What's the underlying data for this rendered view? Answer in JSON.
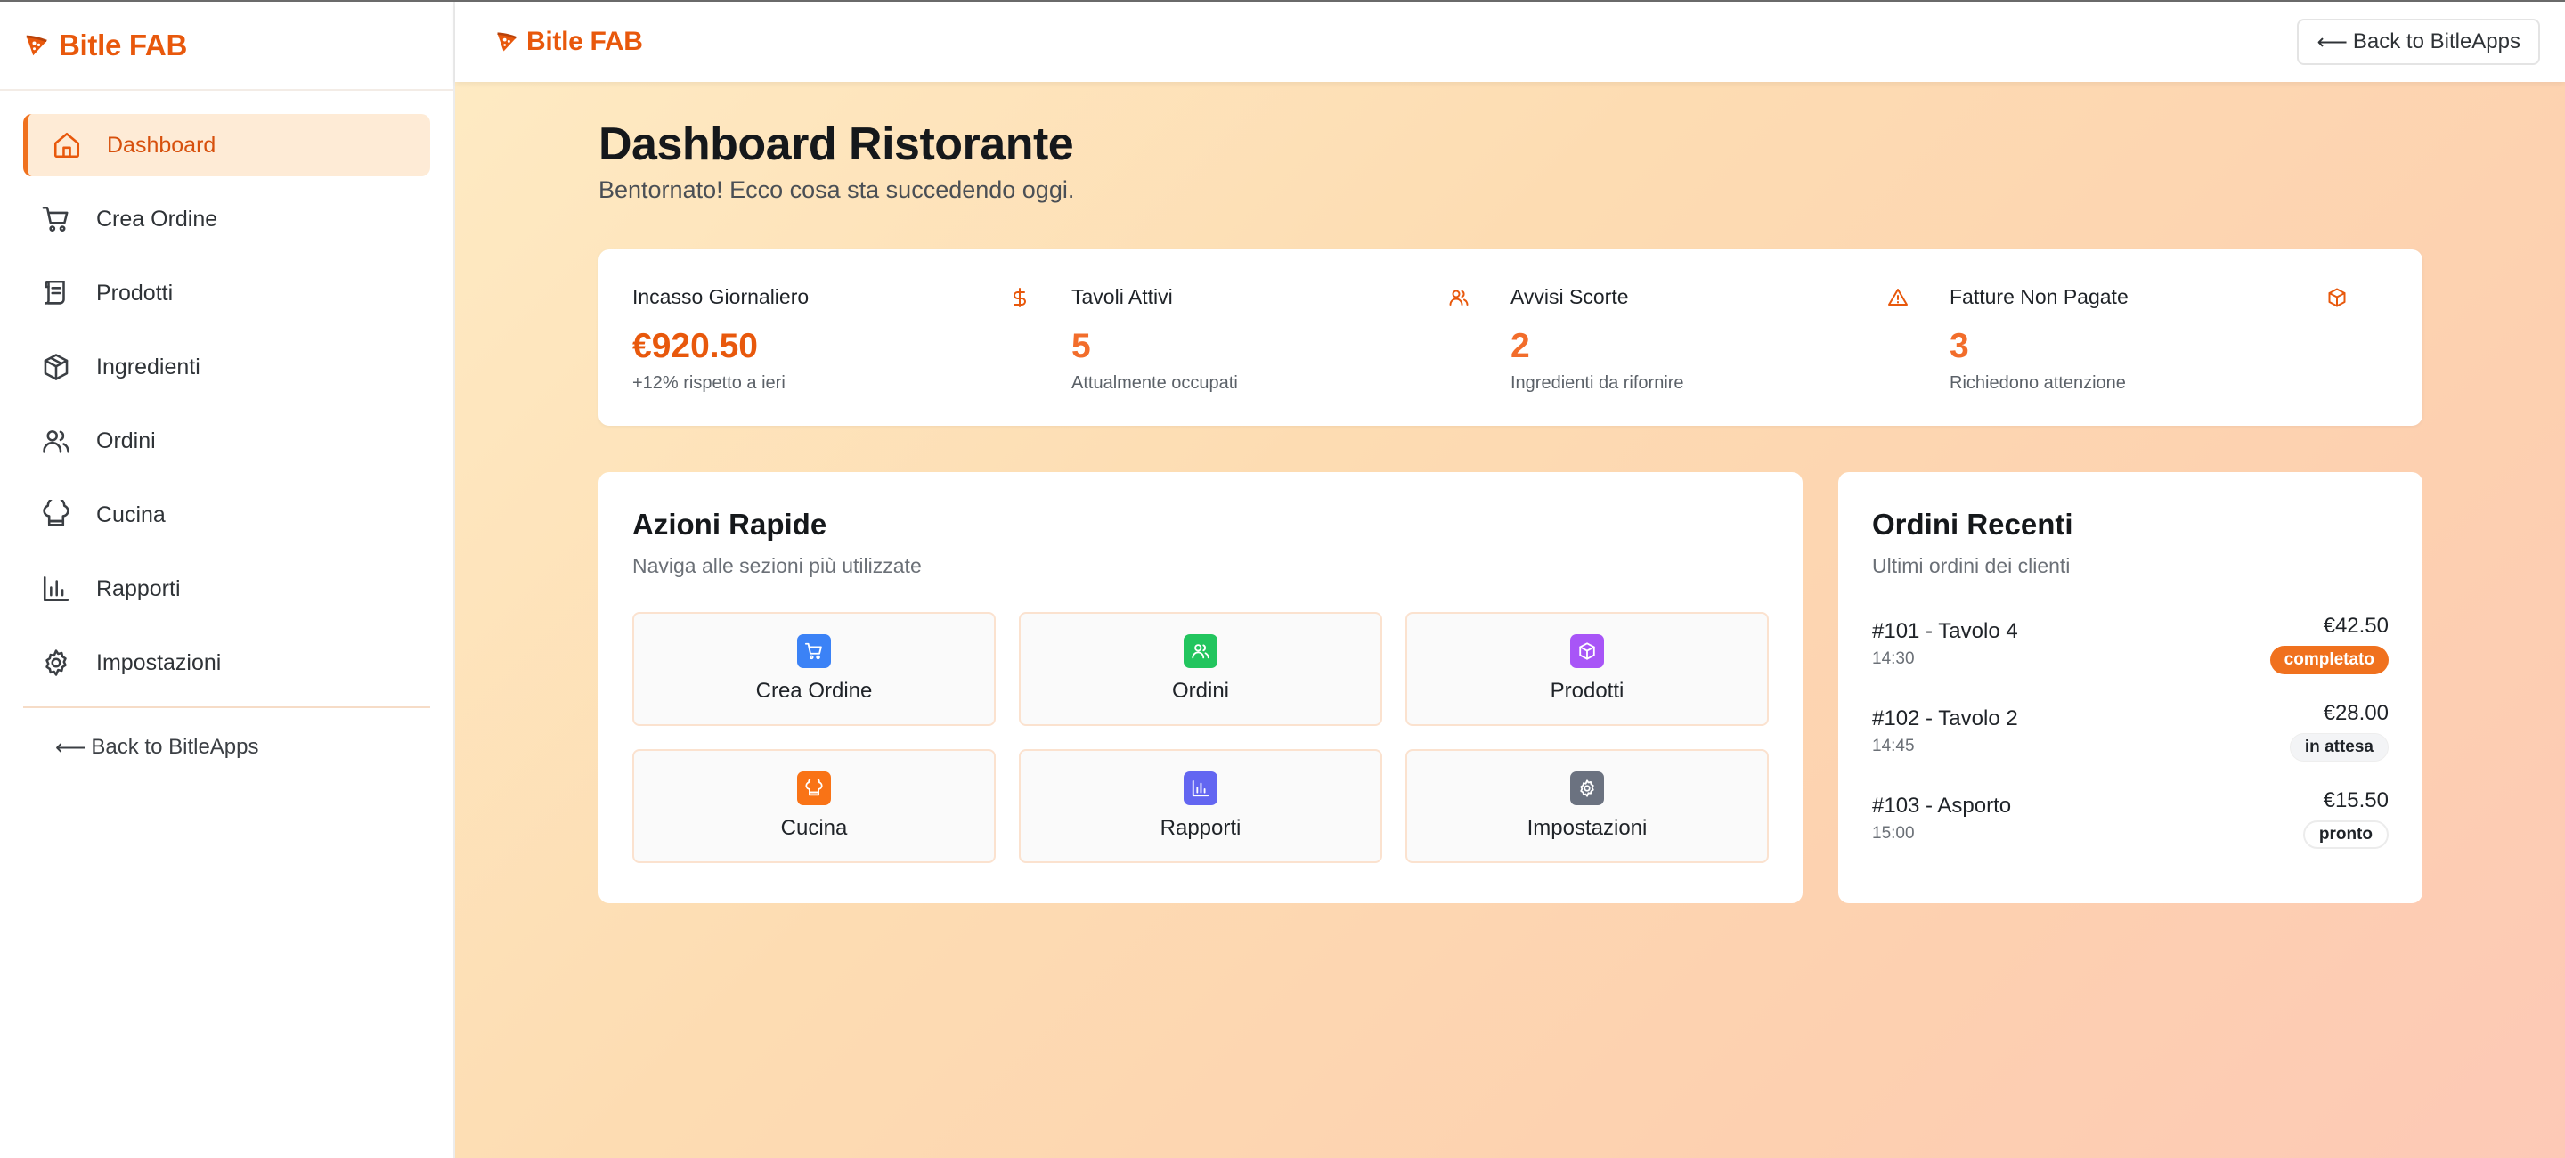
{
  "brand": {
    "name": "Bitle FAB"
  },
  "sidebar": {
    "items": [
      {
        "label": "Dashboard",
        "icon": "home-icon"
      },
      {
        "label": "Crea Ordine",
        "icon": "cart-icon"
      },
      {
        "label": "Prodotti",
        "icon": "scroll-icon"
      },
      {
        "label": "Ingredienti",
        "icon": "package-icon"
      },
      {
        "label": "Ordini",
        "icon": "users-icon"
      },
      {
        "label": "Cucina",
        "icon": "chef-hat-icon"
      },
      {
        "label": "Rapporti",
        "icon": "bar-chart-icon"
      },
      {
        "label": "Impostazioni",
        "icon": "gear-icon"
      }
    ],
    "back_label": "Back to BitleApps"
  },
  "topbar": {
    "back_label": "Back to BitleApps"
  },
  "page": {
    "title": "Dashboard Ristorante",
    "subtitle": "Bentornato! Ecco cosa sta succedendo oggi."
  },
  "stats": [
    {
      "label": "Incasso Giornaliero",
      "value": "€920.50",
      "note": "+12% rispetto a ieri",
      "icon": "dollar-icon"
    },
    {
      "label": "Tavoli Attivi",
      "value": "5",
      "note": "Attualmente occupati",
      "icon": "users-icon"
    },
    {
      "label": "Avvisi Scorte",
      "value": "2",
      "note": "Ingredienti da rifornire",
      "icon": "warning-icon"
    },
    {
      "label": "Fatture Non Pagate",
      "value": "3",
      "note": "Richiedono attenzione",
      "icon": "package-icon"
    }
  ],
  "quick_actions": {
    "title": "Azioni Rapide",
    "subtitle": "Naviga alle sezioni più utilizzate",
    "items": [
      {
        "label": "Crea Ordine",
        "icon": "cart-icon",
        "color": "#3b82f6"
      },
      {
        "label": "Ordini",
        "icon": "users-icon",
        "color": "#22c55e"
      },
      {
        "label": "Prodotti",
        "icon": "package-icon",
        "color": "#a855f7"
      },
      {
        "label": "Cucina",
        "icon": "chef-hat-icon",
        "color": "#f97316"
      },
      {
        "label": "Rapporti",
        "icon": "bar-chart-icon",
        "color": "#6366f1"
      },
      {
        "label": "Impostazioni",
        "icon": "gear-icon",
        "color": "#6b7280"
      }
    ]
  },
  "recent_orders": {
    "title": "Ordini Recenti",
    "subtitle": "Ultimi ordini dei clienti",
    "orders": [
      {
        "id": "#101 - Tavolo 4",
        "time": "14:30",
        "amount": "€42.50",
        "status": "completato"
      },
      {
        "id": "#102 - Tavolo 2",
        "time": "14:45",
        "amount": "€28.00",
        "status": "in attesa"
      },
      {
        "id": "#103 - Asporto",
        "time": "15:00",
        "amount": "€15.50",
        "status": "pronto"
      }
    ]
  },
  "colors": {
    "accent": "#e8580c",
    "active_bg": "#feebd6",
    "status_completed": "#f0711e"
  }
}
